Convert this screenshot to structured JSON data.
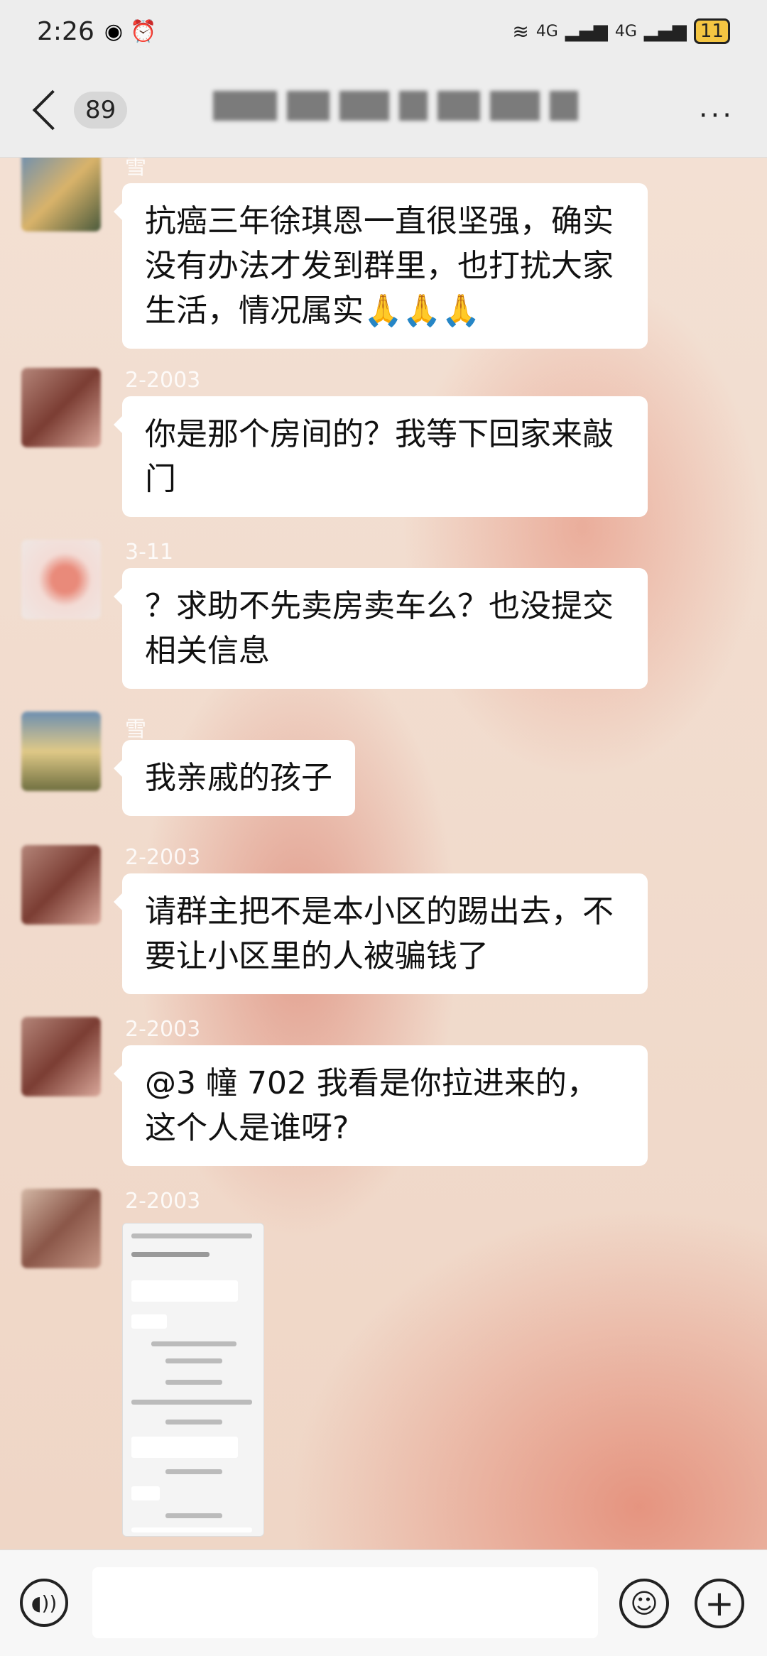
{
  "status_bar": {
    "time": "2:26",
    "network": "4G",
    "battery": "11"
  },
  "header": {
    "back_count": "89",
    "more_label": "···"
  },
  "messages": [
    {
      "sender": "雪",
      "text": "抗癌三年徐琪恩一直很坚强，确实没有办法才发到群里，也打扰大家生活，情况属实🙏🙏🙏"
    },
    {
      "sender": "2-2003",
      "text": "你是那个房间的？我等下回家来敲门"
    },
    {
      "sender": "3-11",
      "text": "？求助不先卖房卖车么？也没提交相关信息"
    },
    {
      "sender": "雪",
      "text": "我亲戚的孩子"
    },
    {
      "sender": "2-2003",
      "text": "请群主把不是本小区的踢出去，不要让小区里的人被骗钱了"
    },
    {
      "sender": "2-2003",
      "text": "@3 幢 702  我看是你拉进来的，这个人是谁呀?"
    },
    {
      "sender": "2-2003",
      "image": "screenshot-image"
    }
  ],
  "input_bar": {
    "voice_icon": "voice-icon",
    "emoji_icon": "emoji-icon",
    "plus_icon": "plus-icon"
  },
  "colors": {
    "bubble": "#ffffff",
    "bar": "#ededed",
    "background": "#f1ddd0"
  }
}
